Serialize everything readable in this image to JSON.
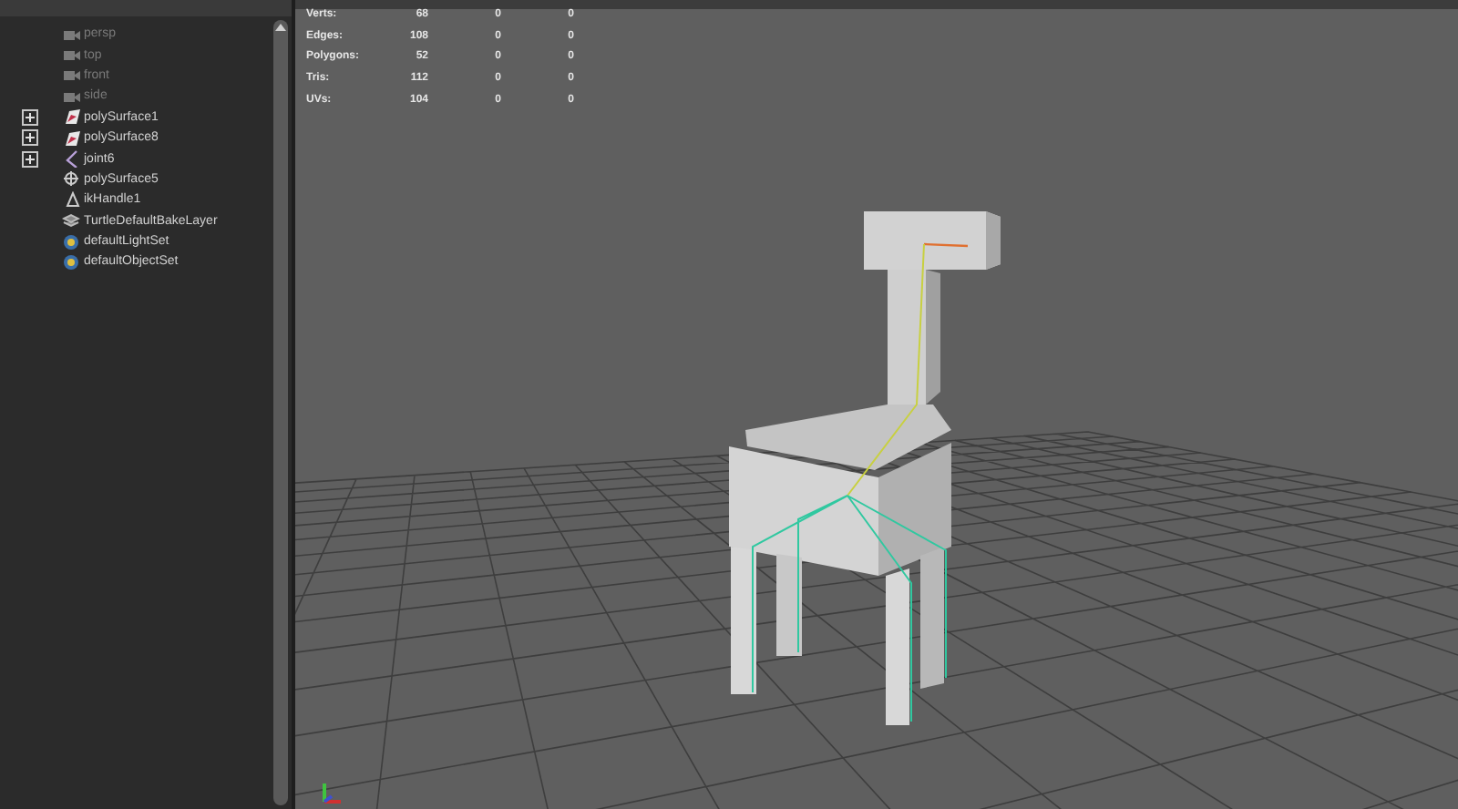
{
  "outliner": {
    "items": [
      {
        "label": "persp",
        "kind": "camera",
        "expandable": false,
        "disabled": true
      },
      {
        "label": "top",
        "kind": "camera",
        "expandable": false,
        "disabled": true
      },
      {
        "label": "front",
        "kind": "camera",
        "expandable": false,
        "disabled": true
      },
      {
        "label": "side",
        "kind": "camera",
        "expandable": false,
        "disabled": true
      },
      {
        "label": "polySurface1",
        "kind": "mesh",
        "expandable": true,
        "disabled": false
      },
      {
        "label": "polySurface8",
        "kind": "mesh",
        "expandable": true,
        "disabled": false
      },
      {
        "label": "joint6",
        "kind": "joint",
        "expandable": true,
        "disabled": false
      },
      {
        "label": "polySurface5",
        "kind": "group",
        "expandable": false,
        "disabled": false
      },
      {
        "label": "ikHandle1",
        "kind": "ik",
        "expandable": false,
        "disabled": false
      },
      {
        "label": "TurtleDefaultBakeLayer",
        "kind": "layer",
        "expandable": false,
        "disabled": false
      },
      {
        "label": "defaultLightSet",
        "kind": "set",
        "expandable": false,
        "disabled": false
      },
      {
        "label": "defaultObjectSet",
        "kind": "set",
        "expandable": false,
        "disabled": false
      }
    ]
  },
  "viewport": {
    "hud": [
      {
        "label": "Verts:",
        "values": [
          "68",
          "0",
          "0"
        ]
      },
      {
        "label": "Edges:",
        "values": [
          "108",
          "0",
          "0"
        ]
      },
      {
        "label": "Polygons:",
        "values": [
          "52",
          "0",
          "0"
        ]
      },
      {
        "label": "Tris:",
        "values": [
          "112",
          "0",
          "0"
        ]
      },
      {
        "label": "UVs:",
        "values": [
          "104",
          "0",
          "0"
        ]
      }
    ]
  }
}
